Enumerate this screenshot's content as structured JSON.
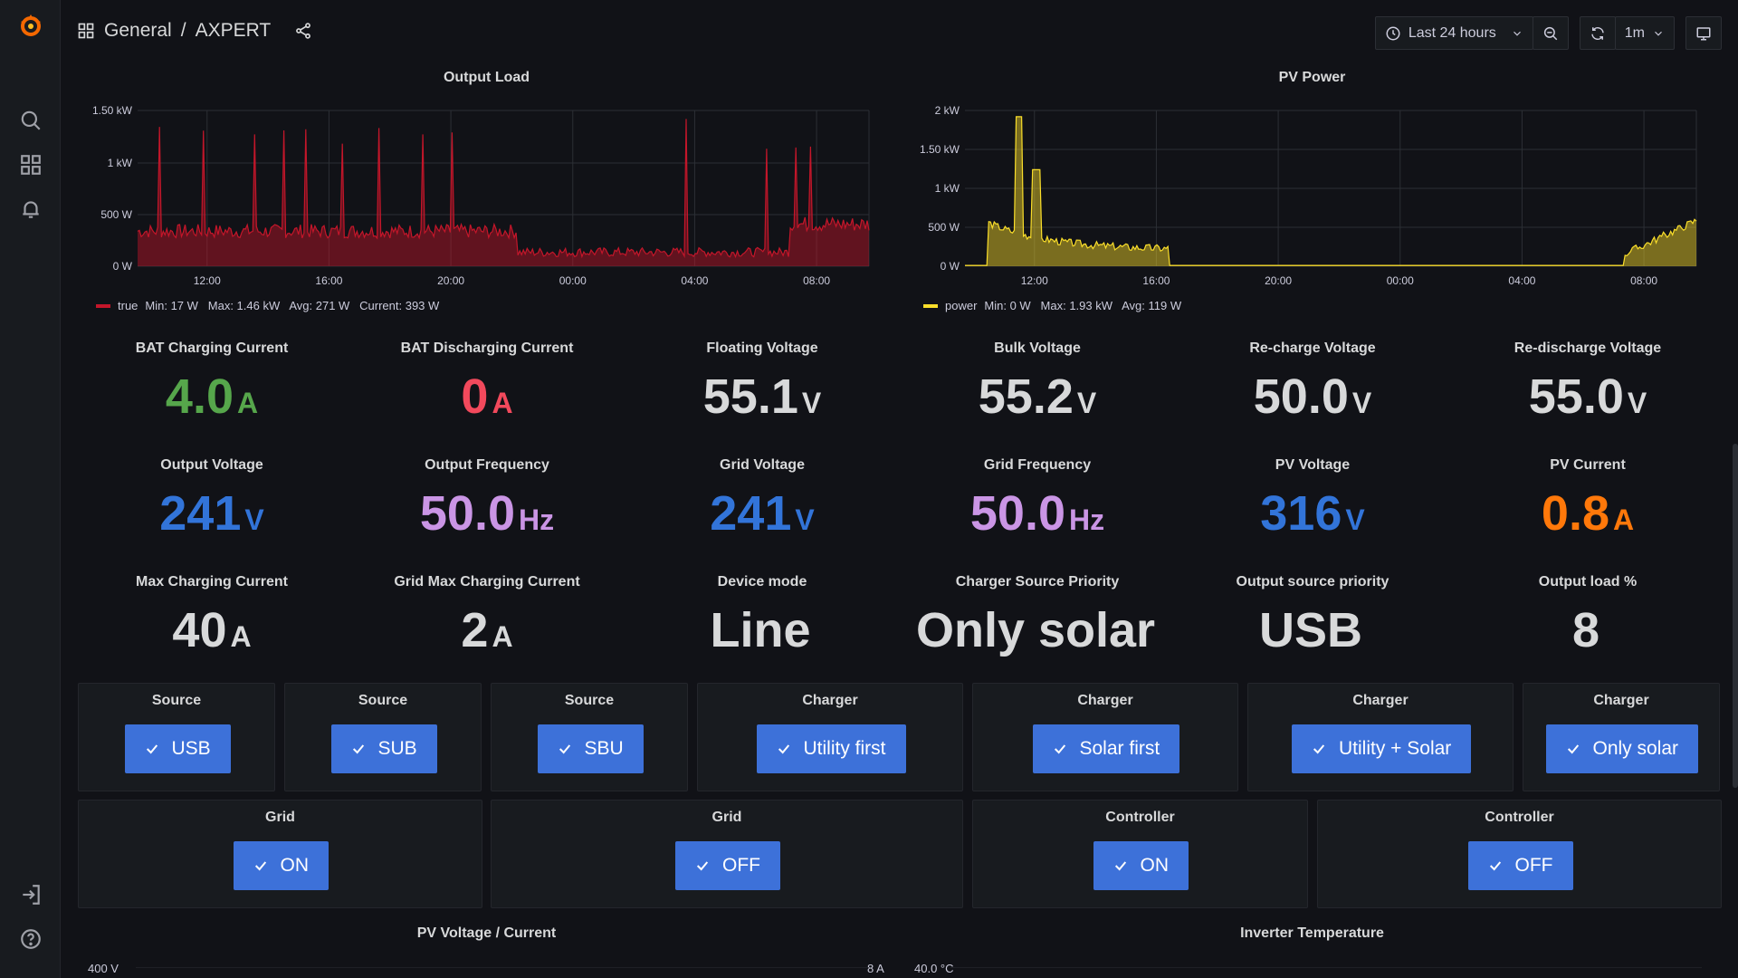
{
  "breadcrumb": {
    "folder": "General",
    "separator": "/",
    "dashboard": "AXPERT"
  },
  "toolbar": {
    "time_range": "Last 24 hours",
    "refresh_interval": "1m"
  },
  "graphs": [
    {
      "title": "Output Load",
      "color": "#c4162a",
      "y_ticks": [
        "1.50 kW",
        "1 kW",
        "500 W",
        "0 W"
      ],
      "x_ticks": [
        "12:00",
        "16:00",
        "20:00",
        "00:00",
        "04:00",
        "08:00"
      ],
      "legend": {
        "series": "true",
        "stats": "Min: 17 W   Max: 1.46 kW   Avg: 271 W   Current: 393 W"
      }
    },
    {
      "title": "PV Power",
      "color": "#fade2a",
      "y_ticks": [
        "2 kW",
        "1.50 kW",
        "1 kW",
        "500 W",
        "0 W"
      ],
      "x_ticks": [
        "12:00",
        "16:00",
        "20:00",
        "00:00",
        "04:00",
        "08:00"
      ],
      "legend": {
        "series": "power",
        "stats": "Min: 0 W   Max: 1.93 kW   Avg: 119 W"
      }
    }
  ],
  "stats": [
    {
      "title": "BAT Charging Current",
      "value": "4.0",
      "unit": "A",
      "color": "#56a64b"
    },
    {
      "title": "BAT Discharging Current",
      "value": "0",
      "unit": "A",
      "color": "#f2495c"
    },
    {
      "title": "Floating Voltage",
      "value": "55.1",
      "unit": "V",
      "color": "#d8d9da"
    },
    {
      "title": "Bulk Voltage",
      "value": "55.2",
      "unit": "V",
      "color": "#d8d9da"
    },
    {
      "title": "Re-charge Voltage",
      "value": "50.0",
      "unit": "V",
      "color": "#d8d9da"
    },
    {
      "title": "Re-discharge Voltage",
      "value": "55.0",
      "unit": "V",
      "color": "#d8d9da"
    },
    {
      "title": "Output Voltage",
      "value": "241",
      "unit": "V",
      "color": "#3274d9"
    },
    {
      "title": "Output Frequency",
      "value": "50.0",
      "unit": "Hz",
      "color": "#ca95e5"
    },
    {
      "title": "Grid Voltage",
      "value": "241",
      "unit": "V",
      "color": "#3274d9"
    },
    {
      "title": "Grid Frequency",
      "value": "50.0",
      "unit": "Hz",
      "color": "#ca95e5"
    },
    {
      "title": "PV Voltage",
      "value": "316",
      "unit": "V",
      "color": "#3274d9"
    },
    {
      "title": "PV Current",
      "value": "0.8",
      "unit": "A",
      "color": "#ff780a"
    },
    {
      "title": "Max Charging Current",
      "value": "40",
      "unit": "A",
      "color": "#d8d9da"
    },
    {
      "title": "Grid Max Charging Current",
      "value": "2",
      "unit": "A",
      "color": "#d8d9da"
    },
    {
      "title": "Device mode",
      "value": "Line",
      "unit": "",
      "color": "#d8d9da"
    },
    {
      "title": "Charger Source Priority",
      "value": "Only solar",
      "unit": "",
      "color": "#d8d9da"
    },
    {
      "title": "Output source priority",
      "value": "USB",
      "unit": "",
      "color": "#d8d9da"
    },
    {
      "title": "Output load %",
      "value": "8",
      "unit": "",
      "color": "#d8d9da"
    }
  ],
  "buttons_row1": [
    {
      "title": "Source",
      "label": "USB"
    },
    {
      "title": "Source",
      "label": "SUB"
    },
    {
      "title": "Source",
      "label": "SBU"
    },
    {
      "title": "Charger",
      "label": "Utility first"
    },
    {
      "title": "Charger",
      "label": "Solar first"
    },
    {
      "title": "Charger",
      "label": "Utility + Solar"
    },
    {
      "title": "Charger",
      "label": "Only solar"
    }
  ],
  "buttons_row2": [
    {
      "title": "Grid",
      "label": "ON"
    },
    {
      "title": "Grid",
      "label": "OFF"
    },
    {
      "title": "Controller",
      "label": "ON"
    },
    {
      "title": "Controller",
      "label": "OFF"
    }
  ],
  "bottom_panels": [
    {
      "title": "PV Voltage / Current",
      "y_left": "400 V",
      "y_right": "8 A"
    },
    {
      "title": "Inverter Temperature",
      "y_left": "40.0 °C"
    }
  ]
}
